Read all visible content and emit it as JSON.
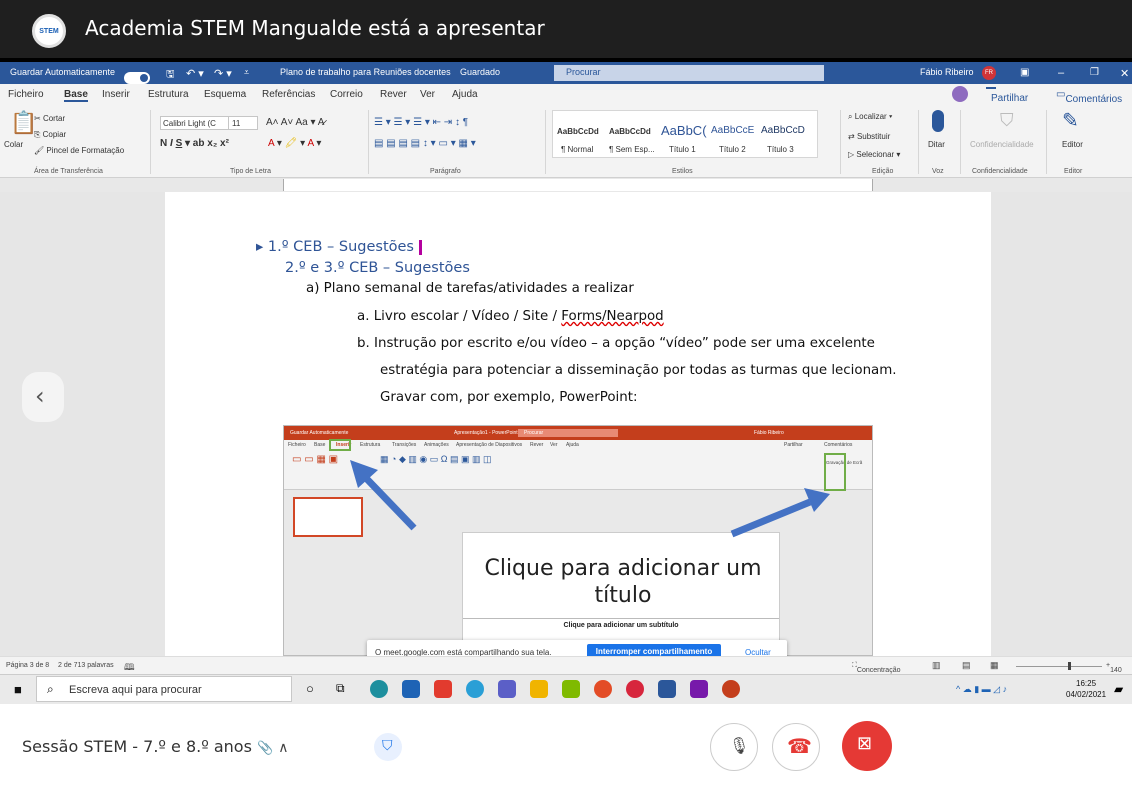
{
  "meet": {
    "presenter_text": "Academia STEM Mangualde está a apresentar",
    "logo_text": "STEM",
    "meeting_title": "Sessão STEM - 7.º e 8.º anos",
    "share_message": "O meet.google.com está compartilhando sua tela.",
    "stop_sharing": "Interromper compartilhamento",
    "hide": "Ocultar"
  },
  "word": {
    "autosave": "Guardar Automaticamente",
    "autosave_state": "On",
    "doc_title": "Plano de trabalho para Reuniões docentes",
    "doc_status": "Guardado",
    "search_placeholder": "Procurar",
    "user_name": "Fábio Ribeiro",
    "user_initials": "FR",
    "menu": [
      "Ficheiro",
      "Base",
      "Inserir",
      "Estrutura",
      "Esquema",
      "Referências",
      "Correio",
      "Rever",
      "Ver",
      "Ajuda"
    ],
    "share": "Partilhar",
    "comments": "Comentários",
    "ribbon": {
      "paste": "Colar",
      "cut": "Cortar",
      "copy": "Copiar",
      "format_painter": "Pincel de Formatação",
      "clipboard_group": "Área de Transferência",
      "font_name": "Calibri Light (C",
      "font_size": "11",
      "font_group": "Tipo de Letra",
      "paragraph_group": "Parágrafo",
      "styles_group": "Estilos",
      "styles": [
        {
          "sample": "AaBbCcDd",
          "name": "¶ Normal"
        },
        {
          "sample": "AaBbCcDd",
          "name": "¶ Sem Esp..."
        },
        {
          "sample": "AaBbC(",
          "name": "Título 1"
        },
        {
          "sample": "AaBbCcE",
          "name": "Título 2"
        },
        {
          "sample": "AaBbCcD",
          "name": "Título 3"
        }
      ],
      "find": "Localizar",
      "replace": "Substituir",
      "select": "Selecionar",
      "editing_group": "Edição",
      "dictate": "Ditar",
      "voice_group": "Voz",
      "sensitivity": "Confidencialidade",
      "sensitivity_group": "Confidencialidade",
      "editor": "Editor",
      "editor_group": "Editor"
    },
    "status": {
      "page": "Página 3 de 8",
      "words": "2 de 713 palavras",
      "focus": "Concentração",
      "zoom": "140"
    }
  },
  "doc": {
    "line1": "1.º CEB – Sugestões",
    "line2": "2.º e 3.º CEB – Sugestões",
    "item_a": "a)   Plano semanal de tarefas/atividades a realizar",
    "item_a1_prefix": "a.   Livro escolar / Vídeo / Site / ",
    "item_a1_link": "Forms/Nearpod",
    "item_b1": "b.   Instrução por escrito e/ou vídeo – a opção “vídeo” pode ser uma excelente",
    "item_b2": "estratégia para potenciar a disseminação por todas as turmas que lecionam.",
    "item_b3": "Gravar com, por exemplo, PowerPoint:"
  },
  "ppt": {
    "title_bar": "Guardar Automaticamente",
    "app": "Apresentação1 - PowerPoint",
    "search": "Procurar",
    "user": "Fábio Ribeiro",
    "tabs": [
      "Ficheiro",
      "Base",
      "Inserir",
      "Estrutura",
      "Transições",
      "Animações",
      "Apresentação de Diapositivos",
      "Rever",
      "Ver",
      "Ajuda"
    ],
    "share": "Partilhar",
    "comments": "Comentários",
    "slide_title": "Clique para adicionar um título",
    "slide_subtitle": "Clique para adicionar um subtítulo",
    "screen_recording": "Gravação de Ecrã"
  },
  "taskbar": {
    "search_placeholder": "Escreva aqui para procurar",
    "time": "16:25",
    "date": "04/02/2021"
  },
  "colors": {
    "word_blue": "#2b579a",
    "ppt_red": "#c43e1c",
    "end_call": "#e53935",
    "arrow_blue": "#4472c4",
    "highlight_green": "#70ad47"
  }
}
